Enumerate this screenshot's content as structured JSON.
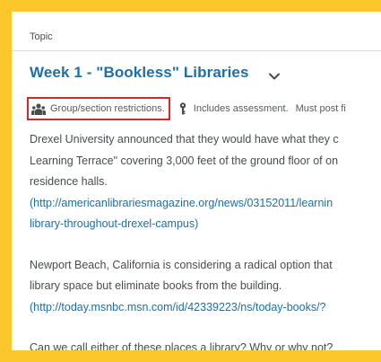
{
  "header": {
    "topic_label": "Topic"
  },
  "topic": {
    "title": "Week 1 - \"Bookless\" Libraries"
  },
  "meta": {
    "restriction_label": "Group/section restrictions.",
    "assessment_label": "Includes assessment.",
    "must_post_label": "Must post fi"
  },
  "content": {
    "p1_line1": "Drexel University announced that they would have what they c",
    "p1_line2": "Learning Terrace\" covering 3,000 feet of the ground floor of on",
    "p1_line3": "residence halls.",
    "p1_link_line1": "(http://americanlibrariesmagazine.org/news/03152011/learnin",
    "p1_link_line2": "library-throughout-drexel-campus)",
    "p2_line1": "Newport Beach, California is considering a radical option that",
    "p2_line2": "library space but eliminate books from the building.",
    "p2_link_line1": "(http://today.msnbc.msn.com/id/42339223/ns/today-books/?",
    "p3_line1": "Can we call either of these places a library? Why or why not?"
  },
  "colors": {
    "frame": "#fcc72a",
    "title": "#1d6fa5",
    "link": "#1d6fa5",
    "restriction_border": "#d9262c",
    "text": "#494c4e"
  },
  "icons": {
    "group": "group-icon",
    "key": "key-icon",
    "chevron": "chevron-down-icon"
  }
}
